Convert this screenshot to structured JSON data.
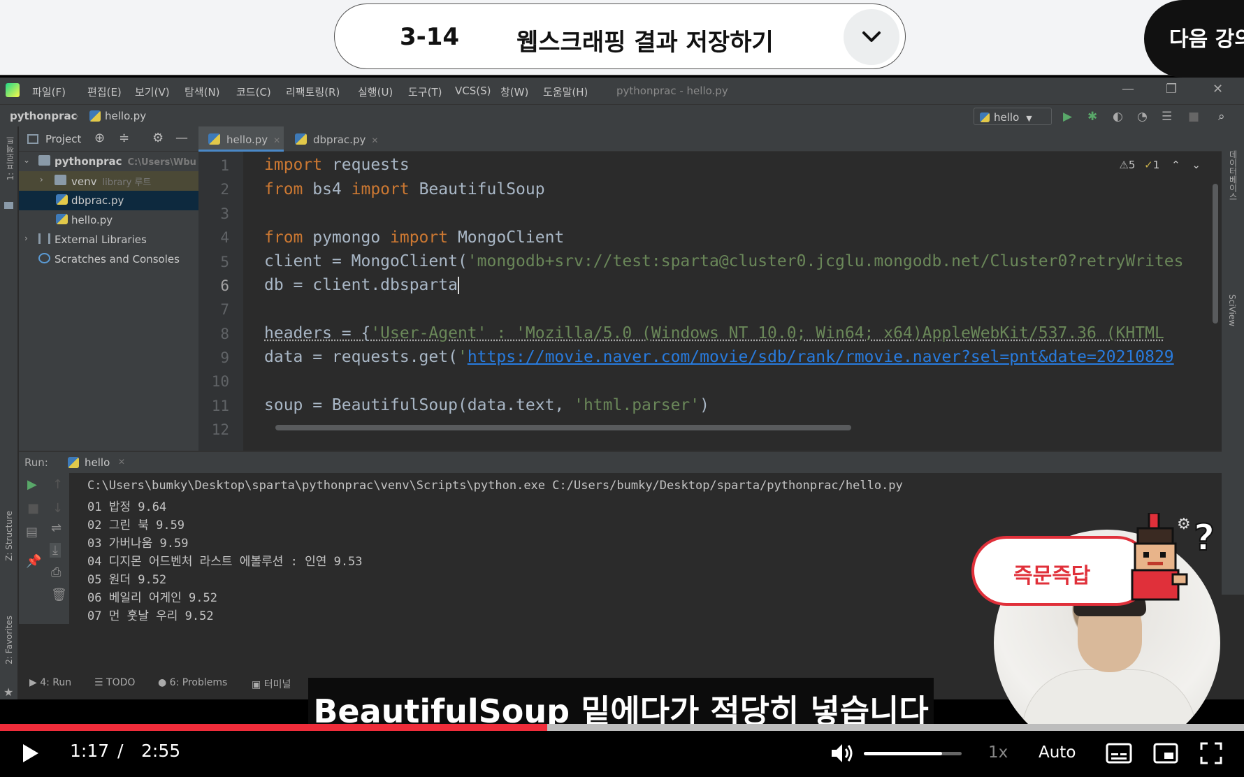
{
  "lecture": {
    "number": "3-14",
    "title": "웹스크래핑 결과 저장하기",
    "next_label": "다음 강의"
  },
  "ide": {
    "menu": [
      "파일(F)",
      "편집(E)",
      "보기(V)",
      "탐색(N)",
      "코드(C)",
      "리팩토링(R)",
      "실행(U)",
      "도구(T)",
      "VCS(S)",
      "창(W)",
      "도움말(H)"
    ],
    "window_title": "pythonprac - hello.py",
    "breadcrumb": [
      "pythonprac",
      "hello.py"
    ],
    "run_config": "hello",
    "left_stripe_label": "1: 프로젝트",
    "structure_label": "Z: Structure",
    "favorites_label": "2: Favorites",
    "right_stripe_labels": [
      "데이터베이스",
      "SciView"
    ],
    "project_header": "Project",
    "tree": [
      {
        "label": "pythonprac",
        "sub": "C:\\Users\\Wbu"
      },
      {
        "label": "venv",
        "sub": "library 루트"
      },
      {
        "label": "dbprac.py",
        "sub": ""
      },
      {
        "label": "hello.py",
        "sub": ""
      },
      {
        "label": "External Libraries",
        "sub": ""
      },
      {
        "label": "Scratches and Consoles",
        "sub": ""
      }
    ],
    "tabs": [
      "hello.py",
      "dbprac.py"
    ],
    "inspections": {
      "warnings": "5",
      "weak": "1"
    },
    "line_numbers": [
      "1",
      "2",
      "3",
      "4",
      "5",
      "6",
      "7",
      "8",
      "9",
      "10",
      "11",
      "12"
    ],
    "run_label": "Run:",
    "run_tab": "hello",
    "console": [
      "C:\\Users\\bumky\\Desktop\\sparta\\pythonprac\\venv\\Scripts\\python.exe C:/Users/bumky/Desktop/sparta/pythonprac/hello.py",
      "01 밥정 9.64",
      "02 그린 북 9.59",
      "03 가버나움 9.59",
      "04 디지몬 어드벤처 라스트 에볼루션 : 인연 9.53",
      "05 원더 9.52",
      "06 베일리 어게인 9.52",
      "07 먼 훗날 우리 9.52"
    ],
    "bottom_tabs": [
      "4: Run",
      "TODO",
      "6: Problems",
      "터미널"
    ]
  },
  "overlay": {
    "qna_label": "즉문즉답",
    "help_mark": "?"
  },
  "subtitle": "BeautifulSoup 밑에다가 적당히 넣습니다",
  "player": {
    "current_time": "1:17",
    "separator": "/",
    "duration": "2:55",
    "speed": "1x",
    "quality": "Auto",
    "progress_fraction": 0.44,
    "volume_fraction": 0.8
  },
  "colors": {
    "accent_red": "#ef2c3a",
    "keyword": "#cc7832",
    "string": "#6a8759",
    "url": "#287bde"
  }
}
